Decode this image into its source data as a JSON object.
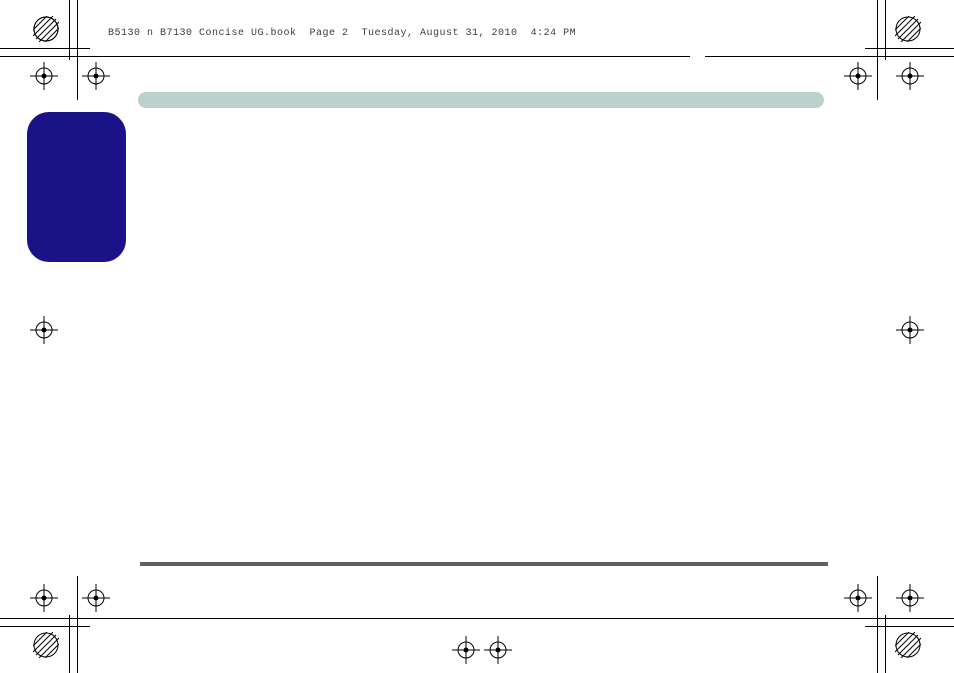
{
  "header": "B5130 n B7130 Concise UG.book  Page 2  Tuesday, August 31, 2010  4:24 PM"
}
